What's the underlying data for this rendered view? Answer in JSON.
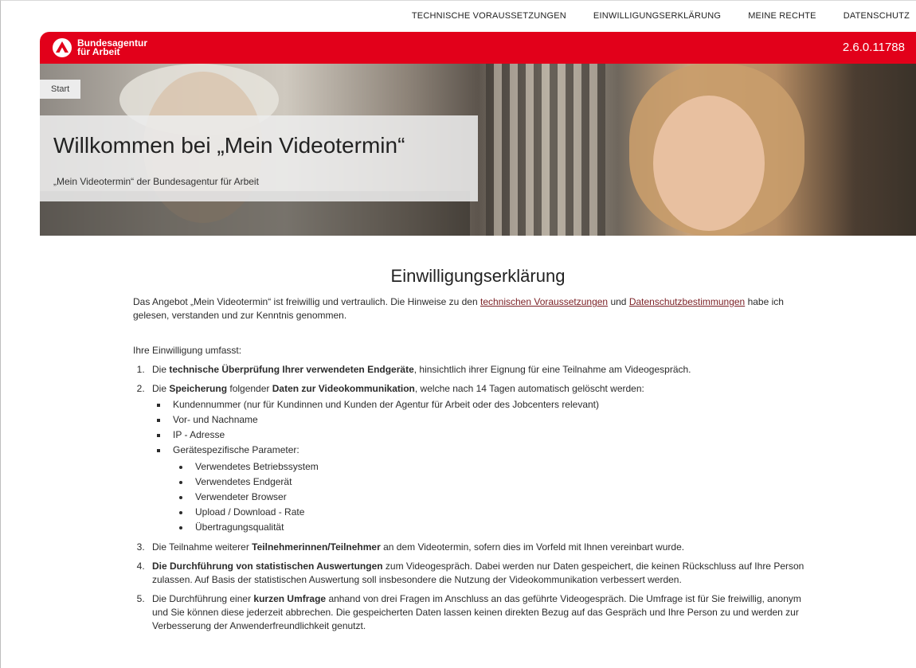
{
  "nav": {
    "items": [
      "TECHNISCHE VORAUSSETZUNGEN",
      "EINWILLIGUNGSERKLÄRUNG",
      "MEINE RECHTE",
      "DATENSCHUTZ"
    ]
  },
  "brand": {
    "line1": "Bundesagentur",
    "line2": "für Arbeit",
    "version": "2.6.0.11788",
    "color": "#e2001a"
  },
  "breadcrumb": "Start",
  "hero": {
    "title": "Willkommen bei „Mein Videotermin“",
    "subtitle": "„Mein Videotermin“ der Bundesagentur für Arbeit"
  },
  "main": {
    "heading": "Einwilligungserklärung",
    "intro": {
      "part1": "Das Angebot „Mein Videotermin“ ist freiwillig und vertraulich. Die Hinweise zu den ",
      "link1": "technischen Voraussetzungen",
      "part2": " und ",
      "link2": "Datenschutzbestimmungen",
      "part3": " habe ich gelesen, verstanden und zur Kenntnis genommen."
    },
    "umfasst": "Ihre Einwilligung umfasst:",
    "item1": {
      "a": "Die ",
      "b": "technische Überprüfung Ihrer verwendeten Endgeräte",
      "c": ", hinsichtlich ihrer Eignung für eine Teilnahme am Videogespräch."
    },
    "item2": {
      "a": "Die ",
      "b": "Speicherung",
      "c": " folgender ",
      "d": "Daten zur Videokommunikation",
      "e": ", welche nach 14 Tagen automatisch gelöscht werden:",
      "sub": [
        "Kundennummer (nur für Kundinnen und Kunden der Agentur für Arbeit oder des Jobcenters relevant)",
        "Vor- und Nachname",
        "IP - Adresse",
        "Gerätespezifische Parameter:"
      ],
      "subsub": [
        "Verwendetes Betriebssystem",
        "Verwendetes Endgerät",
        "Verwendeter Browser",
        "Upload / Download - Rate",
        "Übertragungsqualität"
      ]
    },
    "item3": {
      "a": "Die Teilnahme weiterer ",
      "b": "Teilnehmerinnen/Teilnehmer",
      "c": " an dem Videotermin, sofern dies im Vorfeld mit Ihnen vereinbart wurde."
    },
    "item4": {
      "b": "Die Durchführung von statistischen Auswertungen",
      "c": " zum Videogespräch. Dabei werden nur Daten gespeichert, die keinen Rückschluss auf Ihre Person zulassen. Auf Basis der statistischen Auswertung soll insbesondere die Nutzung der Videokommunikation verbessert werden."
    },
    "item5": {
      "a": "Die Durchführung einer ",
      "b": "kurzen Umfrage",
      "c": " anhand von drei Fragen im Anschluss an das geführte Videogespräch. Die Umfrage ist für Sie freiwillig, anonym und Sie können diese jederzeit abbrechen. Die gespeicherten Daten lassen keinen direkten Bezug auf das Gespräch und Ihre Person zu und werden zur Verbesserung der Anwenderfreundlichkeit genutzt."
    }
  }
}
